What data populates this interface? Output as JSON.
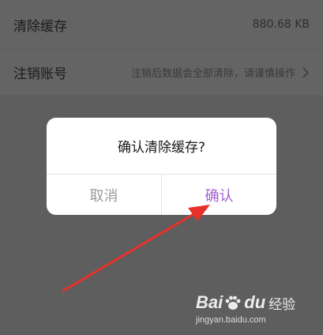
{
  "settings": {
    "clear_cache_label": "清除缓存",
    "cache_size": "880.68 KB",
    "delete_account_label": "注销账号",
    "delete_account_hint": "注销后数据会全部清除，请谨慎操作"
  },
  "dialog": {
    "title": "确认清除缓存?",
    "cancel_label": "取消",
    "confirm_label": "确认"
  },
  "colors": {
    "confirm_accent": "#a262d2",
    "annotation_arrow": "#e8312a"
  },
  "watermark": {
    "brand_bai": "Bai",
    "brand_du": "du",
    "brand_suffix": "经验",
    "url": "jingyan.baidu.com"
  }
}
